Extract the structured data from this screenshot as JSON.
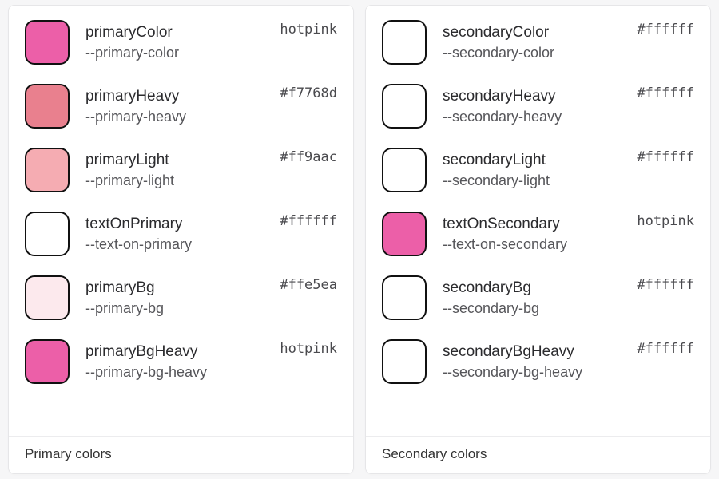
{
  "panels": [
    {
      "title": "Primary colors",
      "items": [
        {
          "name": "primaryColor",
          "cssVar": "--primary-color",
          "value": "hotpink",
          "swatch": "#ec5fa8"
        },
        {
          "name": "primaryHeavy",
          "cssVar": "--primary-heavy",
          "value": "#f7768d",
          "swatch": "#e9808e"
        },
        {
          "name": "primaryLight",
          "cssVar": "--primary-light",
          "value": "#ff9aac",
          "swatch": "#f5acb2"
        },
        {
          "name": "textOnPrimary",
          "cssVar": "--text-on-primary",
          "value": "#ffffff",
          "swatch": "#ffffff"
        },
        {
          "name": "primaryBg",
          "cssVar": "--primary-bg",
          "value": "#ffe5ea",
          "swatch": "#fce9ed"
        },
        {
          "name": "primaryBgHeavy",
          "cssVar": "--primary-bg-heavy",
          "value": "hotpink",
          "swatch": "#ec5fa8"
        }
      ]
    },
    {
      "title": "Secondary colors",
      "items": [
        {
          "name": "secondaryColor",
          "cssVar": "--secondary-color",
          "value": "#ffffff",
          "swatch": "#ffffff"
        },
        {
          "name": "secondaryHeavy",
          "cssVar": "--secondary-heavy",
          "value": "#ffffff",
          "swatch": "#ffffff"
        },
        {
          "name": "secondaryLight",
          "cssVar": "--secondary-light",
          "value": "#ffffff",
          "swatch": "#ffffff"
        },
        {
          "name": "textOnSecondary",
          "cssVar": "--text-on-secondary",
          "value": "hotpink",
          "swatch": "#ec5fa8"
        },
        {
          "name": "secondaryBg",
          "cssVar": "--secondary-bg",
          "value": "#ffffff",
          "swatch": "#ffffff"
        },
        {
          "name": "secondaryBgHeavy",
          "cssVar": "--secondary-bg-heavy",
          "value": "#ffffff",
          "swatch": "#ffffff"
        }
      ]
    }
  ]
}
